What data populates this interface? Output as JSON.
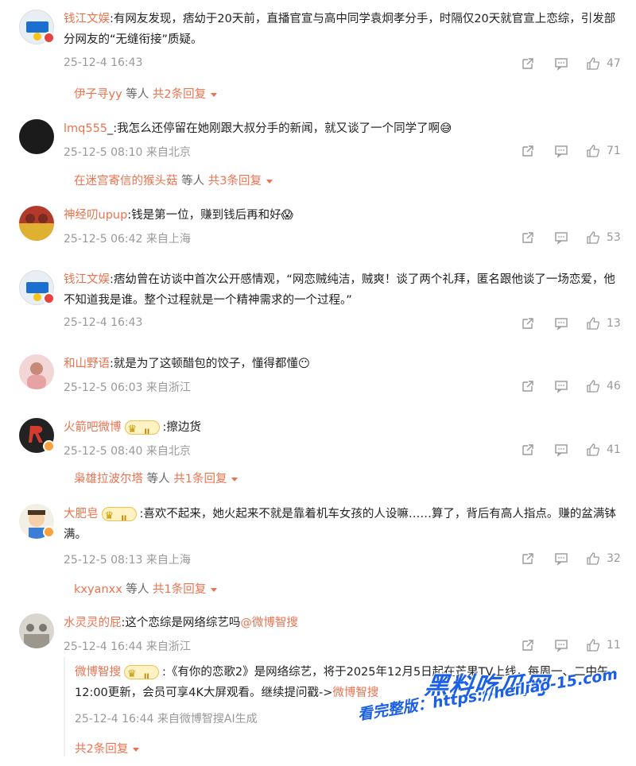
{
  "colors": {
    "accent": "#eb7350",
    "meta": "#999999",
    "text": "#222222",
    "watermark": "#1a5fe6"
  },
  "comments": [
    {
      "author": "钱江文娱",
      "text": ":有网友发现，痞幼于20天前，直播官宣与高中同学袁炯孝分手，时隔仅20天就官宣上恋综，引发部分网友的“无缝衔接”质疑。",
      "meta": "25-12-4 16:43",
      "likes": "47",
      "replies": {
        "name": "伊子寻yy",
        "mid": " 等人 ",
        "count": "共2条回复"
      }
    },
    {
      "author": "lmq555",
      "text": "_:我怎么还停留在她刚跟大叔分手的新闻，就又谈了一个同学了啊",
      "emoji": "😅",
      "meta": "25-12-5 08:10 来自北京",
      "likes": "71",
      "replies": {
        "name": "在迷宫寄信的猴头菇",
        "mid": " 等人 ",
        "count": "共3条回复"
      }
    },
    {
      "author": "神经叨upup",
      "text": ":钱是第一位，赚到钱后再和好",
      "emoji": "😱",
      "meta": "25-12-5 06:42 来自上海",
      "likes": "53"
    },
    {
      "author": "钱江文娱",
      "text": ":痞幼曾在访谈中首次公开感情观，“网恋贼纯洁，贼爽！谈了两个礼拜，匿名跟他谈了一场恋爱，他不知道我是谁。整个过程就是一个精神需求的一个过程。”",
      "meta": "25-12-4 16:43",
      "likes": "13"
    },
    {
      "author": "和山野语",
      "text": ":就是为了这顿醋包的饺子，懂得都懂",
      "emoji": "😶",
      "meta": "25-12-5 06:03 来自浙江",
      "likes": "46"
    },
    {
      "author": "火箭吧微博",
      "text": ":擦边货",
      "meta": "25-12-5 08:40 来自北京",
      "likes": "41",
      "replies": {
        "name": "枭雄拉波尔塔",
        "mid": " 等人 ",
        "count": "共1条回复"
      }
    },
    {
      "author": "大肥皂",
      "text": ":喜欢不起来，她火起来不就是靠着机车女孩的人设嘛……算了，背后有高人指点。赚的盆满钵满。",
      "meta": "25-12-5 08:13 来自上海",
      "likes": "32",
      "replies": {
        "name": "kxyanxx",
        "mid": " 等人 ",
        "count": "共1条回复"
      }
    },
    {
      "author": "水灵灵的屁",
      "text": ":这个恋综是网络综艺吗",
      "mention": "@微博智搜",
      "meta": "25-12-4 16:44 来自浙江",
      "likes": "11"
    }
  ],
  "sub_reply": {
    "author": "微博智搜",
    "text": ":《有你的恋歌2》是网络综艺，将于2025年12月5日起在芒果TV上线，每周一、二中午12:00更新，会员可享4K大屏观看。继续提问戳->",
    "link": "微博智搜",
    "meta": "25-12-4 16:44 来自微博智搜AI生成",
    "more": "共2条回复"
  },
  "watermark": {
    "line1": "黑料吃瓜网",
    "line2": "看完整版：https://heiliao-15.com"
  }
}
